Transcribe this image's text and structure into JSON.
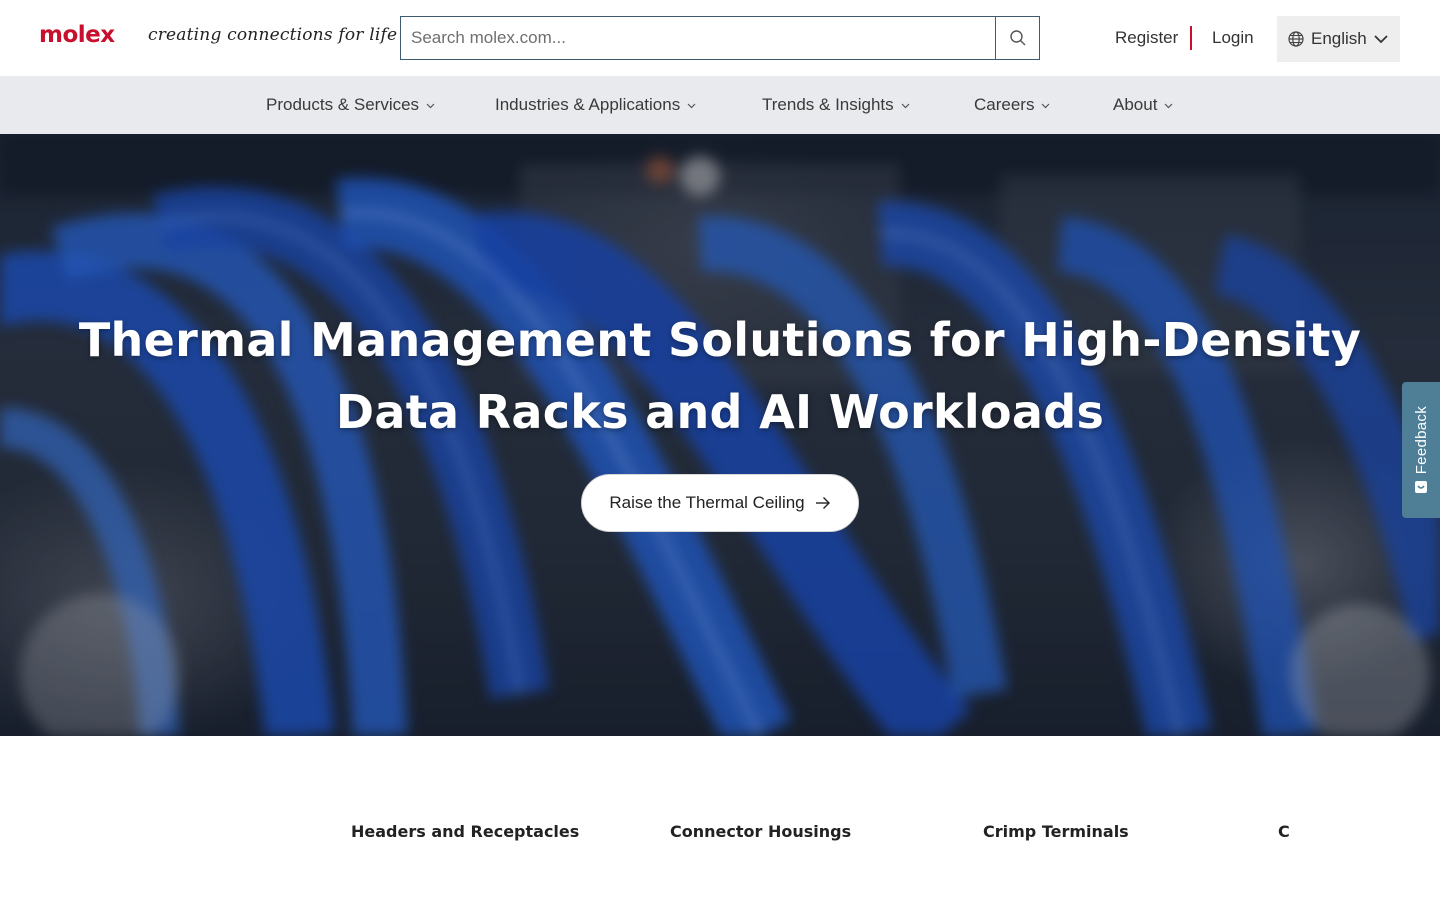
{
  "header": {
    "logo": "molex",
    "tagline": "creating connections for life",
    "search": {
      "placeholder": "Search molex.com..."
    },
    "register_label": "Register",
    "login_label": "Login",
    "language": "English"
  },
  "nav": {
    "items": [
      {
        "label": "Products & Services"
      },
      {
        "label": "Industries & Applications"
      },
      {
        "label": "Trends & Insights"
      },
      {
        "label": "Careers"
      },
      {
        "label": "About"
      }
    ]
  },
  "hero": {
    "title_line1": "Thermal Management Solutions for High-Density",
    "title_line2": "Data Racks and AI Workloads",
    "cta_label": "Raise the Thermal Ceiling"
  },
  "feedback": {
    "label": "Feedback"
  },
  "categories": [
    {
      "label": "Headers and Receptacles"
    },
    {
      "label": "Connector Housings"
    },
    {
      "label": "Crimp Terminals"
    },
    {
      "label": "C"
    }
  ],
  "colors": {
    "brand_red": "#c8102e",
    "nav_bg": "#e8eaed",
    "feedback_bg": "#4f7f96",
    "search_border": "#3e5a6e"
  },
  "icons": {
    "search": "search-icon",
    "globe": "globe-icon",
    "chevron": "chevron-down-icon",
    "arrow": "arrow-right-icon",
    "feedback": "feedback-icon"
  }
}
